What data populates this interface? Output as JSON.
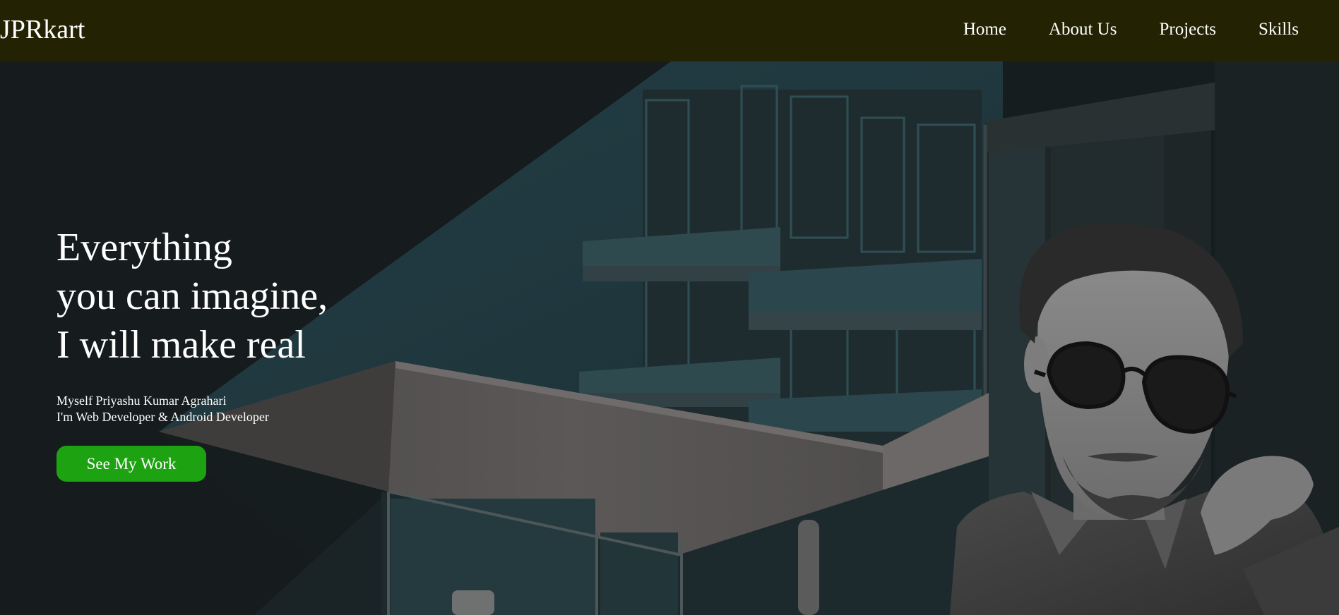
{
  "navbar": {
    "brand": "JPRkart",
    "links": [
      "Home",
      "About Us",
      "Projects",
      "Skills"
    ]
  },
  "hero": {
    "headline": [
      "Everything",
      "you can imagine,",
      "I will make real"
    ],
    "intro": [
      "Myself Priyashu Kumar Agrahari",
      "I'm Web Developer & Android Developer"
    ],
    "cta_label": "See My Work"
  },
  "colors": {
    "navbar_bg": "#232304",
    "hero_bg": "#161d1f",
    "cta_bg": "#1da212",
    "text": "#ffffff"
  }
}
